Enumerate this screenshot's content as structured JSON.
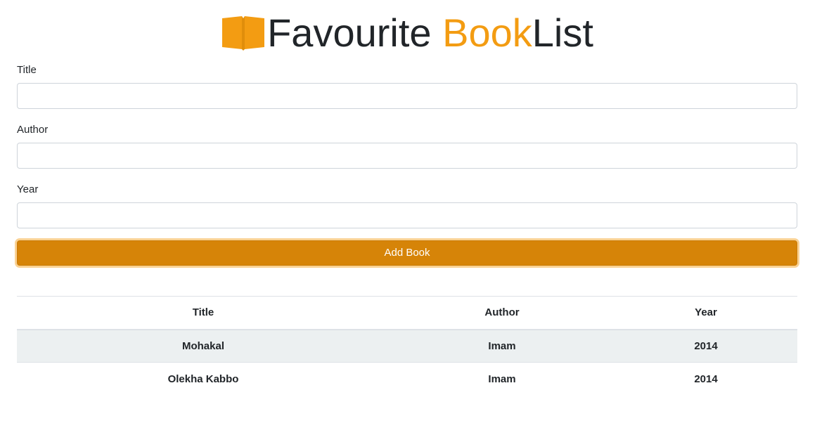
{
  "header": {
    "title_part1": "Favourite ",
    "title_accent": "Book",
    "title_part2": "List",
    "icon": "open-book-icon",
    "accent_color": "#f39c12"
  },
  "form": {
    "title_label": "Title",
    "title_value": "",
    "author_label": "Author",
    "author_value": "",
    "year_label": "Year",
    "year_value": "",
    "submit_label": "Add Book",
    "button_color": "#d68408"
  },
  "table": {
    "headers": [
      "Title",
      "Author",
      "Year"
    ],
    "rows": [
      [
        "Mohakal",
        "Imam",
        "2014"
      ],
      [
        "Olekha Kabbo",
        "Imam",
        "2014"
      ]
    ],
    "stripe_color": "#ecf0f1"
  }
}
